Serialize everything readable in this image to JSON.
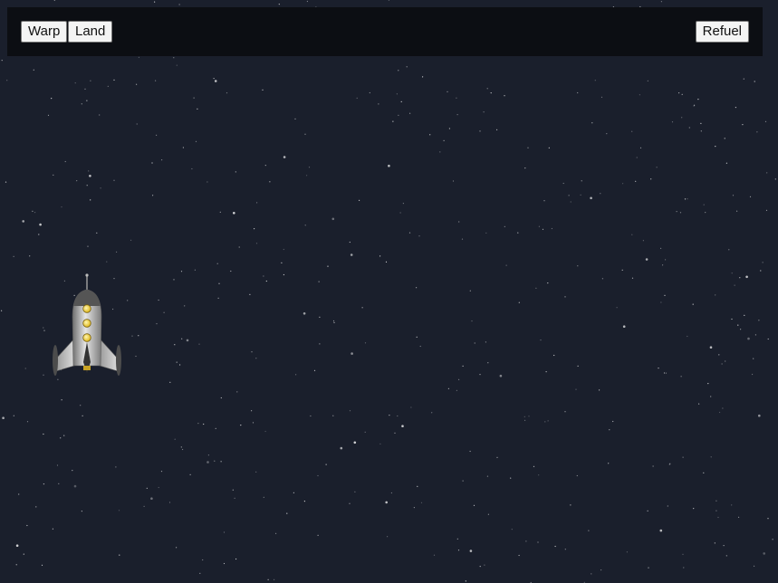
{
  "toolbar": {
    "warp_label": "Warp",
    "land_label": "Land",
    "refuel_label": "Refuel"
  },
  "colors": {
    "space": "#1a1f2c",
    "toolbar": "#0c0e13",
    "portholes": "#f3d23a"
  }
}
